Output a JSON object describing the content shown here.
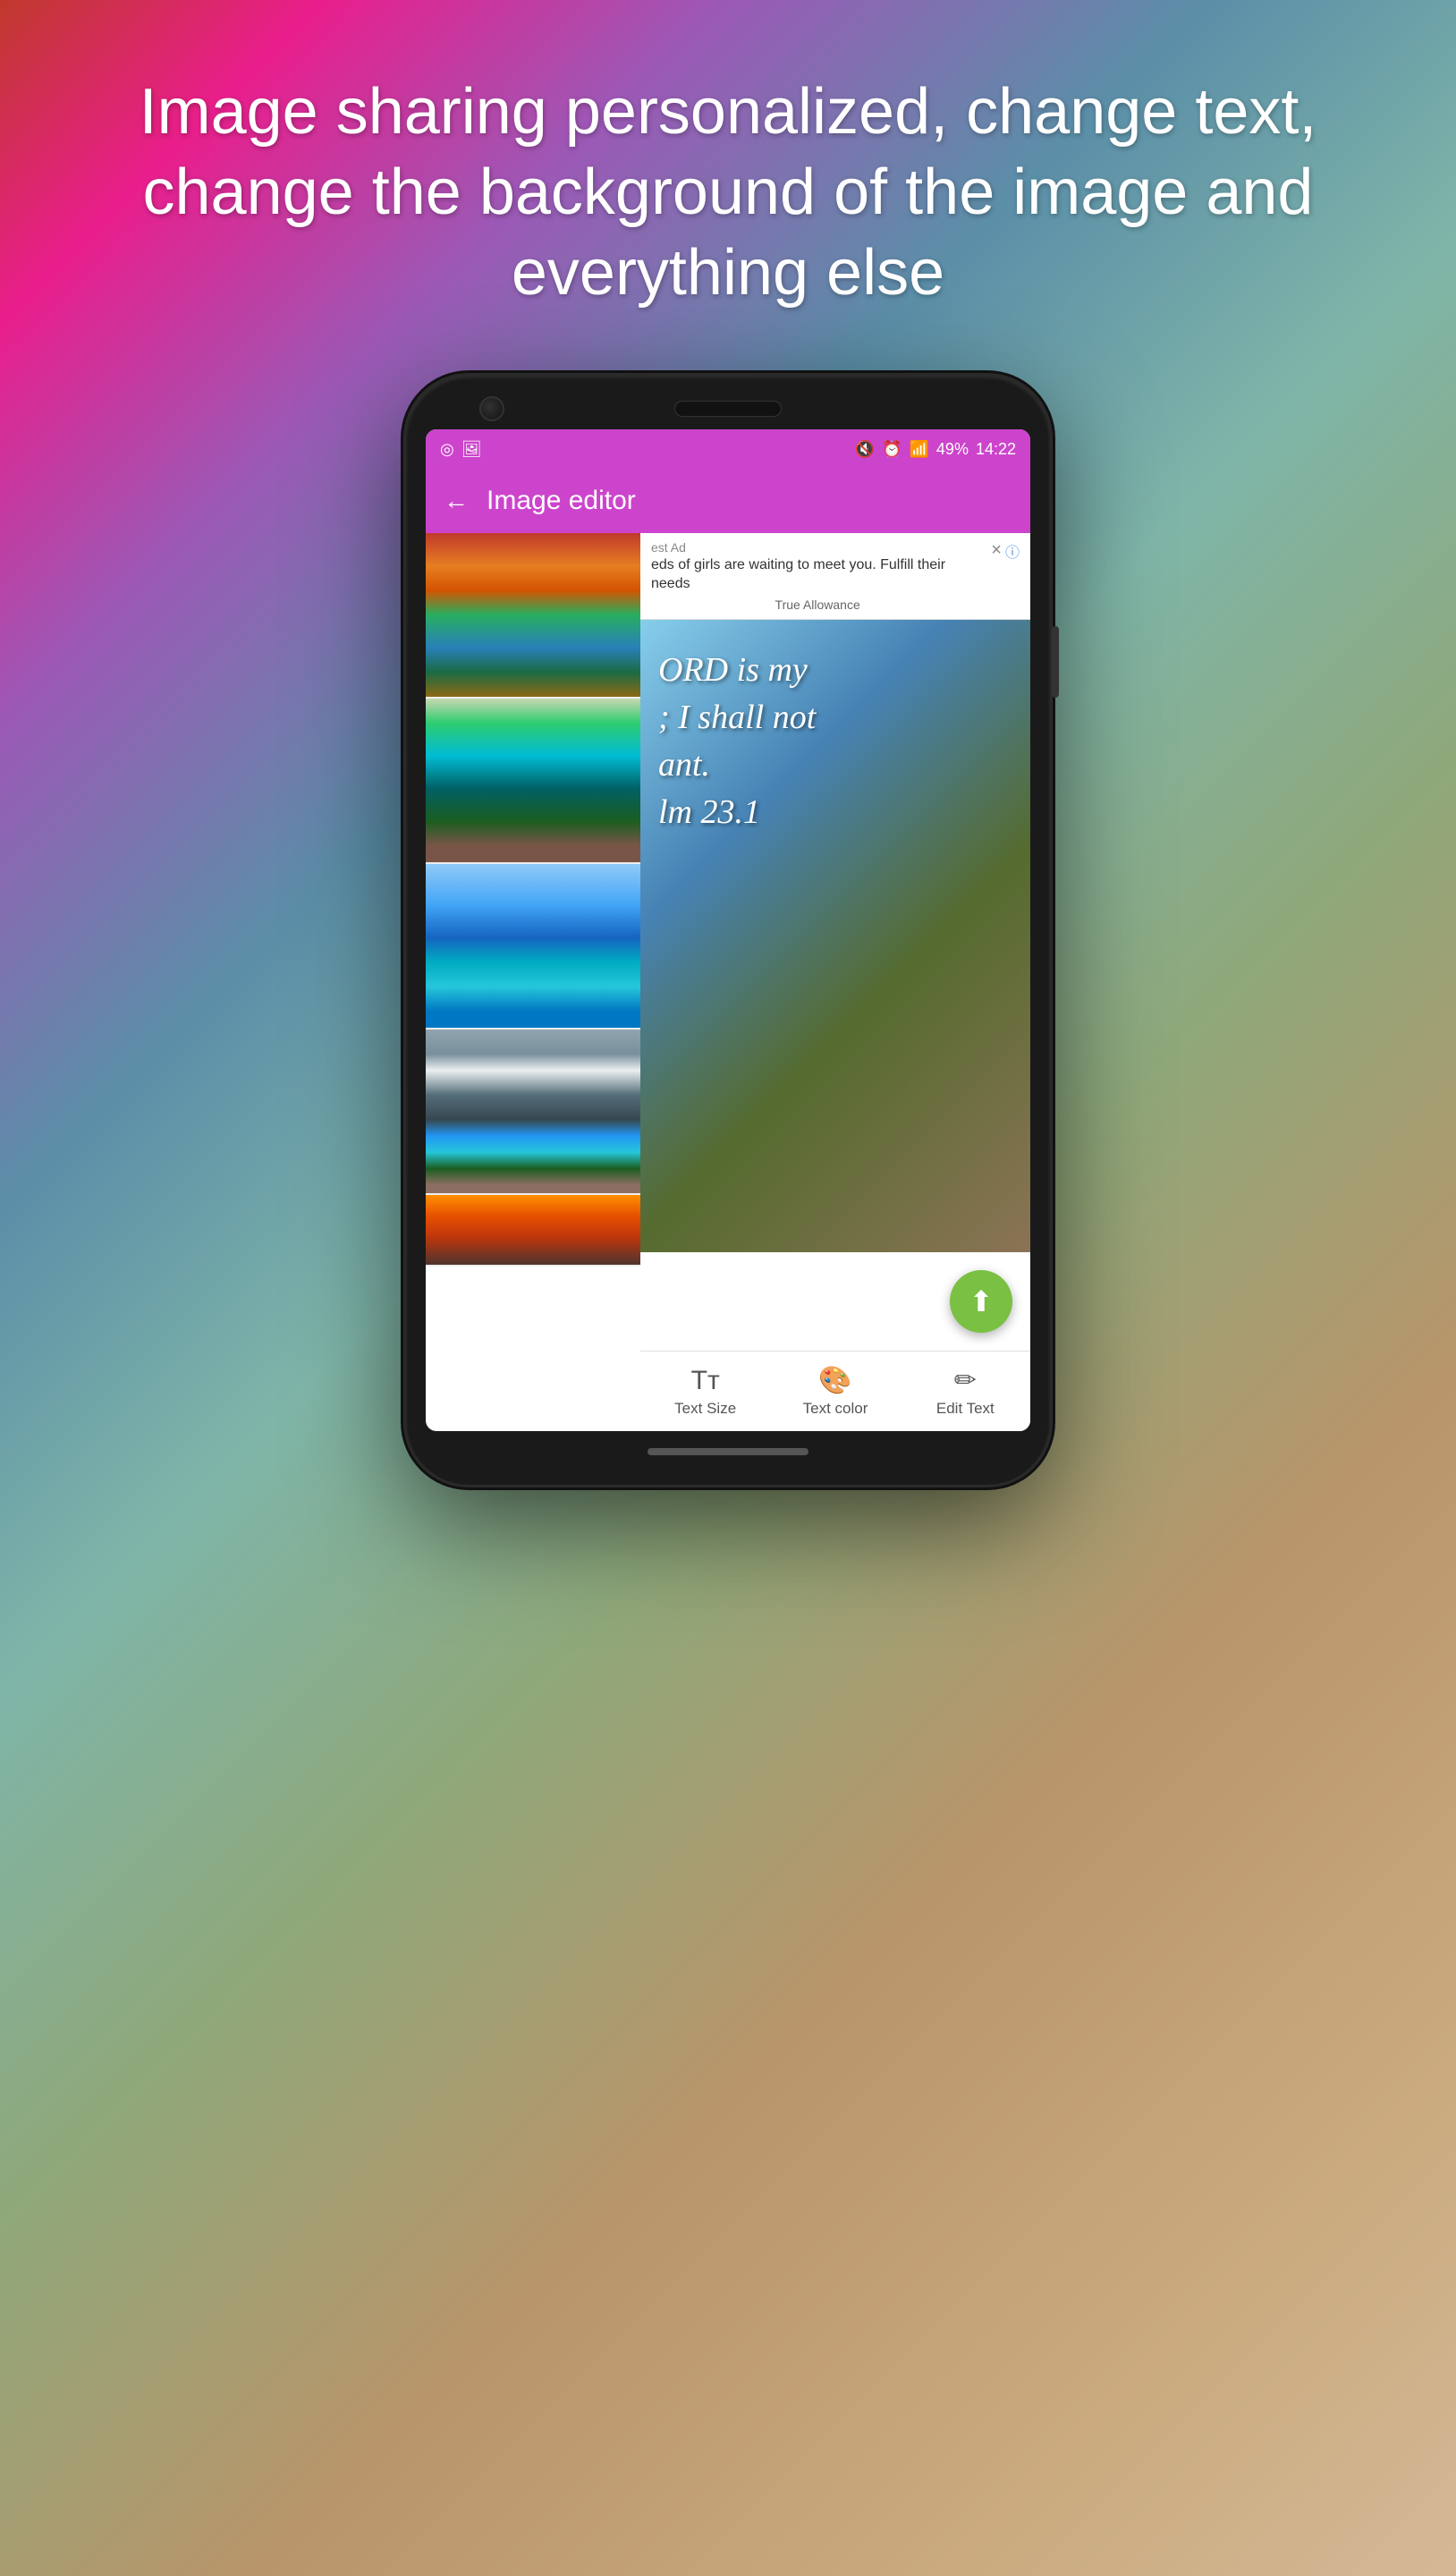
{
  "background": {
    "gradient_description": "colorful blurred gradient from red/pink top-left to teal/brown/beige bottom-right"
  },
  "headline": {
    "text": "Image sharing personalized, change text, change the background of the image and everything else"
  },
  "phone": {
    "status_bar": {
      "battery": "49%",
      "time": "14:22",
      "icons_left": [
        "circle-icon",
        "image-icon"
      ],
      "icons_right": [
        "mute-icon",
        "alarm-icon",
        "wifi-icon",
        "signal-icon",
        "battery-icon"
      ]
    },
    "app_bar": {
      "title": "Image editor",
      "back_label": "←"
    },
    "ad_banner": {
      "label": "est Ad",
      "text": "eds of girls are waiting to meet you. Fulfill their needs",
      "source": "True Allowance",
      "close_btn": "×",
      "info_btn": "ⓘ"
    },
    "scripture_overlay": {
      "line1": "ORD is my",
      "line2": "; I shall not",
      "line3": "ant.",
      "line4": "lm 23.1"
    },
    "images": [
      {
        "id": 1,
        "scene": "autumn-trees-lake",
        "css_class": "scene-autumn"
      },
      {
        "id": 2,
        "scene": "teal-mountain-lake",
        "css_class": "scene-teal-lake"
      },
      {
        "id": 3,
        "scene": "pier-blue-lake",
        "css_class": "scene-pier"
      },
      {
        "id": 4,
        "scene": "moraine-lake-mountains",
        "css_class": "scene-moraine"
      },
      {
        "id": 5,
        "scene": "autumn-forest",
        "css_class": "scene-autumn2"
      }
    ],
    "toolbar": {
      "buttons": [
        {
          "id": "text-size",
          "label": "Text Size",
          "icon": "Tт"
        },
        {
          "id": "text-color",
          "label": "Text color",
          "icon": "🎨"
        },
        {
          "id": "edit-text",
          "label": "Edit Text",
          "icon": "✏"
        }
      ]
    },
    "fab": {
      "icon": "⬆",
      "label": "share",
      "color": "#7ac043"
    }
  }
}
